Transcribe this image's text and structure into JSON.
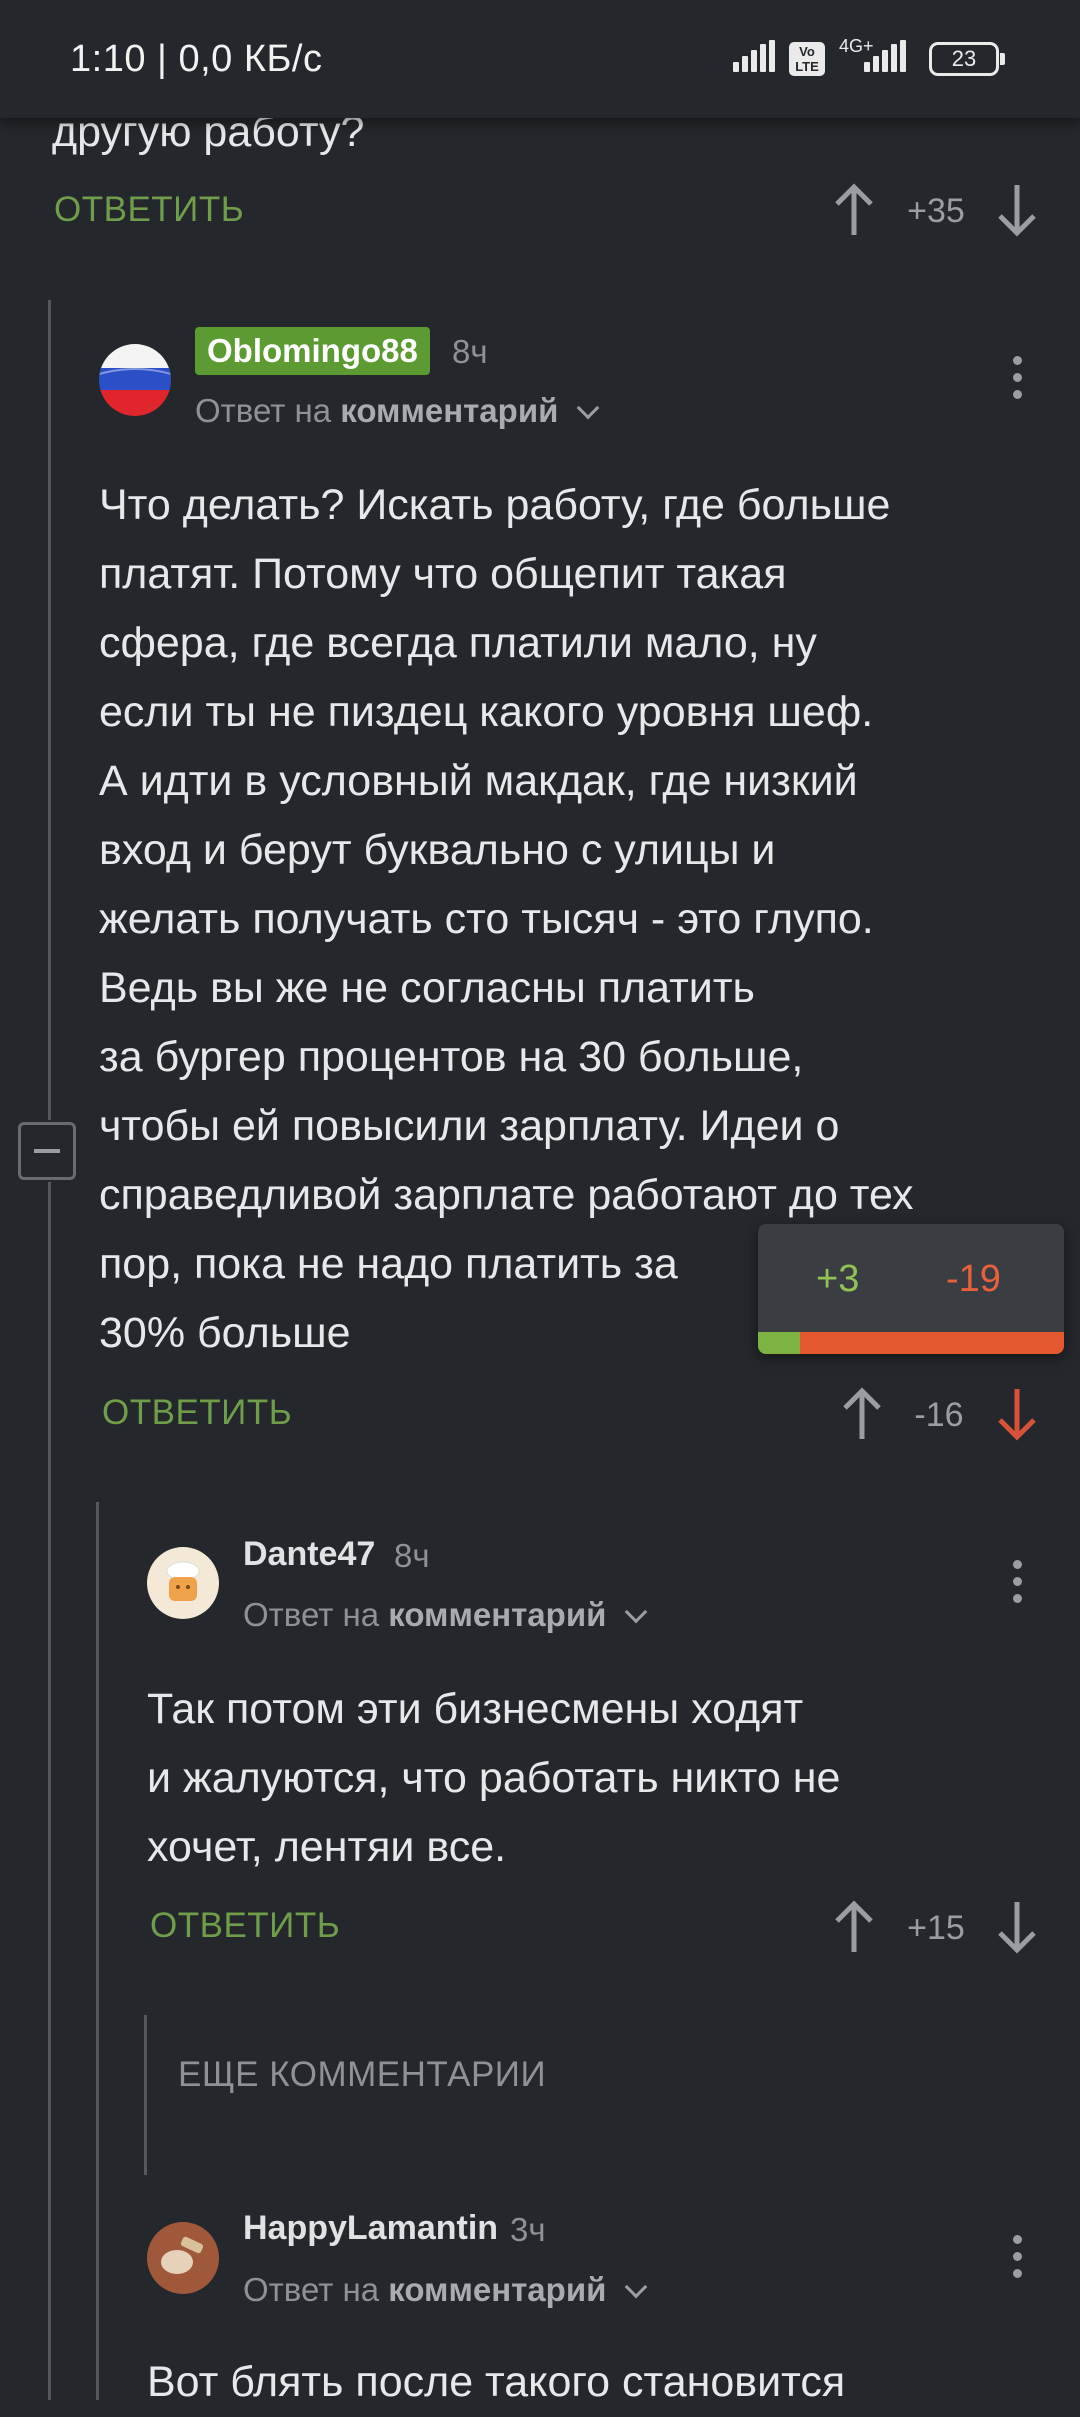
{
  "status_bar": {
    "time": "1:10 | 0,0 КБ/с",
    "volte": "Vo LTE",
    "network": "4G+",
    "battery": "23"
  },
  "top_comment_tail": {
    "text": "другую работу?",
    "reply_label": "ОТВЕТИТЬ",
    "rating": "+35"
  },
  "comment_1": {
    "username": "Oblomingo88",
    "time": "8ч",
    "reply_prefix": "Ответ на",
    "reply_target": "комментарий",
    "text": "Что делать? Искать работу, где больше\nплатят. Потому что общепит такая\nсфера, где всегда платили мало, ну\nесли ты не пиздец какого уровня шеф.\nА идти в условный макдак, где низкий\nвход и берут буквально с улицы и\nжелать получать сто тысяч - это глупо.\nВедь вы же не согласны платить\nза бургер процентов на 30 больше,\nчтобы ей повысили зарплату. Идеи о\nсправедливой зарплате работают до тех\nпор, пока не надо платить за\n30% больше",
    "reply_label": "ОТВЕТИТЬ",
    "rating": "-16",
    "vote_breakdown": {
      "plus": "+3",
      "minus": "-19",
      "plus_count": 3,
      "minus_count": 19
    }
  },
  "comment_2": {
    "username": "Dante47",
    "time": "8ч",
    "reply_prefix": "Ответ на",
    "reply_target": "комментарий",
    "text": "Так потом эти бизнесмены ходят\nи жалуются, что работать никто не\nхочет, лентяи все.",
    "reply_label": "ОТВЕТИТЬ",
    "rating": "+15"
  },
  "more_comments_label": "ЕЩЕ КОММЕНТАРИИ",
  "comment_3": {
    "username": "HappyLamantin",
    "time": "3ч",
    "reply_prefix": "Ответ на",
    "reply_target": "комментарий",
    "text_partial": "Вот блять после такого становится"
  },
  "colors": {
    "background": "#24272b",
    "reply_green": "#6f9e4a",
    "downvote_red": "#d6533a",
    "badge_green": "#5c9a32"
  }
}
